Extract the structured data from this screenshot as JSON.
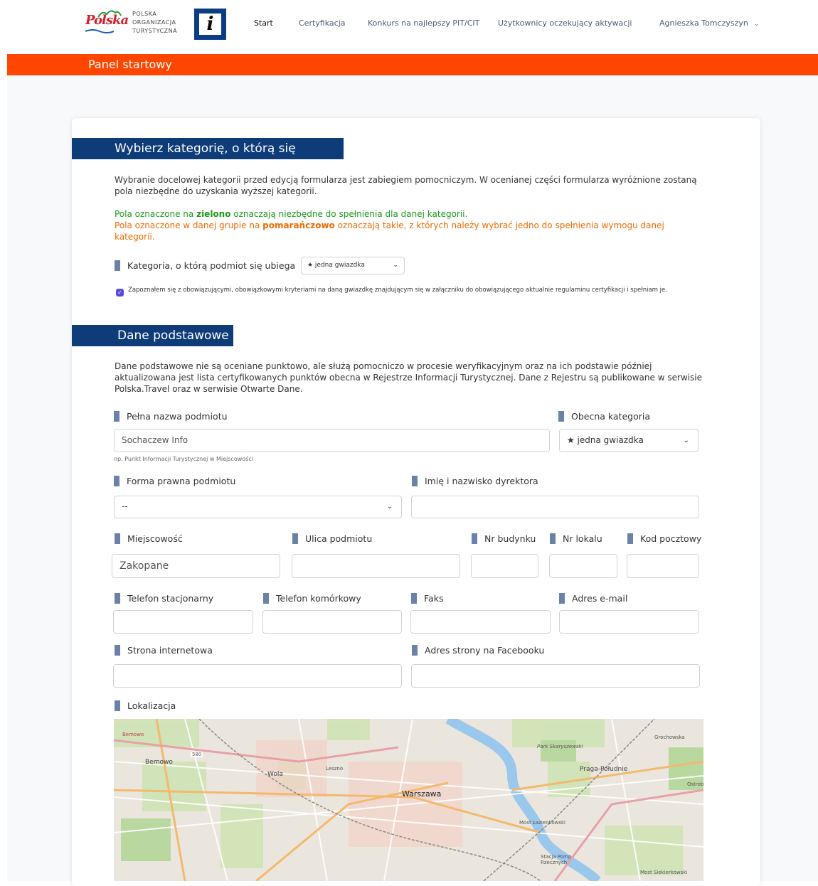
{
  "nav": {
    "logo_text": [
      "POLSKA",
      "ORGANIZACJA",
      "TURYSTYCZNA"
    ],
    "logo_mark": "Polska",
    "info_symbol": "i",
    "items": [
      {
        "label": "Start",
        "active": true
      },
      {
        "label": "Certyfikacja",
        "active": false
      },
      {
        "label": "Konkurs na najlepszy PIT/CIT",
        "active": false
      },
      {
        "label": "Użytkownicy oczekujący aktywacji",
        "active": false
      }
    ],
    "user_name": "Agnieszka Tomczyszyn",
    "user_chevron_icon": "chevron-down-icon"
  },
  "banner": {
    "title": "Panel startowy",
    "color": "#ff4600"
  },
  "category_section": {
    "heading": "Wybierz kategorię, o którą się ubiegasz",
    "intro": "Wybranie docelowej kategorii przed edycją formularza jest zabiegiem pomocniczym. W ocenianej części formularza wyróżnione zostaną pola niezbędne do uzyskania wyższej kategorii.",
    "green_prefix": "Pola oznaczone na ",
    "green_word": "zielono",
    "green_suffix": " oznaczają niezbędne do spełnienia dla danej kategorii.",
    "orange_prefix": "Pola oznaczone w danej grupie na ",
    "orange_word": "pomarańczowo",
    "orange_suffix": " oznaczają takie, z których należy wybrać jedno do spełnienia wymogu danej kategorii.",
    "category_label": "Kategoria, o którą podmiot się ubiega",
    "category_value": "★ jedna gwiazdka",
    "checkbox_checked": true,
    "checkbox_text": "Zapoznałem się z obowiązującymi, obowiązkowymi kryteriami na daną gwiazdkę znajdującym się w załączniku do obowiązującego aktualnie regulaminu certyfikacji i spełniam je."
  },
  "basic_section": {
    "heading": "Dane podstawowe",
    "intro": "Dane podstawowe nie są oceniane punktowo, ale służą pomocniczo w procesie weryfikacyjnym oraz na ich podstawie później aktualizowana jest lista certyfikowanych punktów obecna w Rejestrze Informacji Turystycznej. Dane z Rejestru są publikowane w serwisie Polska.Travel oraz w serwisie Otwarte Dane.",
    "fields": {
      "full_name": {
        "label": "Pełna nazwa podmiotu",
        "value": "Sochaczew Info",
        "hint": "np. Punkt Informacji Turystycznej w Miejscowości"
      },
      "current_category": {
        "label": "Obecna kategoria",
        "value": "★ jedna gwiazdka"
      },
      "legal_form": {
        "label": "Forma prawna podmiotu",
        "value": "--"
      },
      "director": {
        "label": "Imię i nazwisko dyrektora",
        "value": ""
      },
      "city": {
        "label": "Miejscowość",
        "value": "Zakopane"
      },
      "street": {
        "label": "Ulica podmiotu",
        "value": ""
      },
      "building": {
        "label": "Nr budynku",
        "value": ""
      },
      "unit": {
        "label": "Nr lokalu",
        "value": ""
      },
      "postal": {
        "label": "Kod pocztowy",
        "value": ""
      },
      "landline": {
        "label": "Telefon stacjonarny",
        "value": ""
      },
      "mobile": {
        "label": "Telefon komórkowy",
        "value": ""
      },
      "fax": {
        "label": "Faks",
        "value": ""
      },
      "email": {
        "label": "Adres e-mail",
        "value": ""
      },
      "website": {
        "label": "Strona internetowa",
        "value": ""
      },
      "facebook": {
        "label": "Adres strony na Facebooku",
        "value": ""
      },
      "location": {
        "label": "Lokalizacja"
      }
    },
    "map_labels": {
      "bemowo_top": "Bemowo",
      "bemowo": "Bemowo",
      "road": "580",
      "wola": "Wola",
      "warszawa": "Warszawa",
      "park": "Park Skaryszewski",
      "praga": "Praga-Południe",
      "ostrobramska": "Ostroba",
      "grochowska": "Grochowska",
      "most_l": "Most Łazienkowski",
      "stacja": "Stacja Pomp\nRzecznych",
      "most_s": "Most Siekierkowski",
      "leszno": "Leszno"
    }
  }
}
